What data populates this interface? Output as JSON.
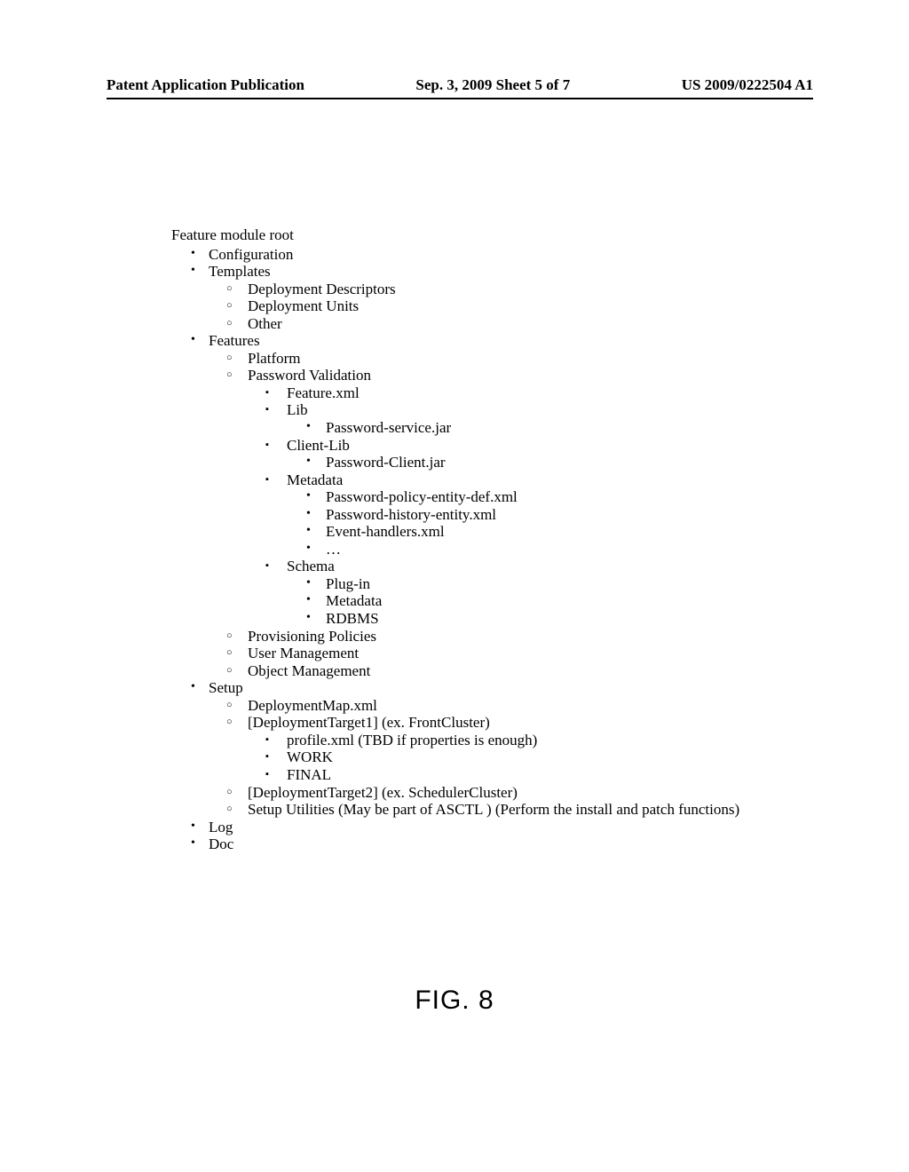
{
  "header": {
    "left": "Patent Application Publication",
    "center": "Sep. 3, 2009  Sheet 5 of 7",
    "right": "US 2009/0222504 A1"
  },
  "root": "Feature module root",
  "l1": {
    "configuration": "Configuration",
    "templates": "Templates",
    "features": "Features",
    "setup": "Setup",
    "log": "Log",
    "doc": "Doc"
  },
  "templates": {
    "dd": "Deployment Descriptors",
    "du": "Deployment Units",
    "other": "Other"
  },
  "features": {
    "platform": "Platform",
    "pwval": "Password Validation",
    "pwval_items": {
      "feature": "Feature.xml",
      "lib": "Lib",
      "lib_items": {
        "pwservice": "Password-service.jar"
      },
      "clientlib": "Client-Lib",
      "clientlib_items": {
        "pwclient": "Password-Client.jar"
      },
      "metadata": "Metadata",
      "metadata_items": {
        "policy": "Password-policy-entity-def.xml",
        "history": "Password-history-entity.xml",
        "handlers": "Event-handlers.xml",
        "ellipsis": "…"
      },
      "schema": "Schema",
      "schema_items": {
        "plugin": "Plug-in",
        "metadata": "Metadata",
        "rdbms": "RDBMS"
      }
    },
    "provpol": "Provisioning Policies",
    "usermgmt": "User Management",
    "objmgmt": "Object Management"
  },
  "setup": {
    "depmap": "DeploymentMap.xml",
    "dt1": "[DeploymentTarget1] (ex. FrontCluster)",
    "dt1_items": {
      "profile": "profile.xml (TBD if properties is enough)",
      "work": "WORK",
      "final": "FINAL"
    },
    "dt2": "[DeploymentTarget2] (ex. SchedulerCluster)",
    "utils": "Setup Utilities (May be part of ASCTL ) (Perform the install and patch functions)"
  },
  "figure": "FIG. 8"
}
